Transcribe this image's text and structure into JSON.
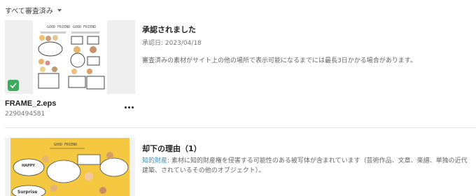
{
  "filter": {
    "label": "すべて審査済み",
    "icon": "chevron-down-icon"
  },
  "items": [
    {
      "status_title": "承認されました",
      "date_label": "承認日: 2023/04/18",
      "description": "審査済みの素材がサイト上の他の場所で表示可能になるまでには最長3日かかる場合があります。",
      "file_name": "FRAME_2.eps",
      "file_id": "2290494581",
      "thumbnail_heading": "GOOD FRIEND",
      "badge_icon": "check-icon",
      "badge_color": "#3cab5d"
    },
    {
      "status_title": "却下の理由（1）",
      "reason_link": "知的財産",
      "reason_text": ": 素材に知的財産権を侵害する可能性のある被写体が含まれています（芸術作品、文章、楽譜、単独の近代建築、されているその他のオブジェクト）。",
      "thumbnail_heading": "GOOD FRIEND",
      "thumbnail_bubble_1": "HAPPY",
      "thumbnail_bubble_2": "Surprise",
      "thumbnail_bg": "#f5c842",
      "link_color": "#3d8fc9"
    }
  ]
}
